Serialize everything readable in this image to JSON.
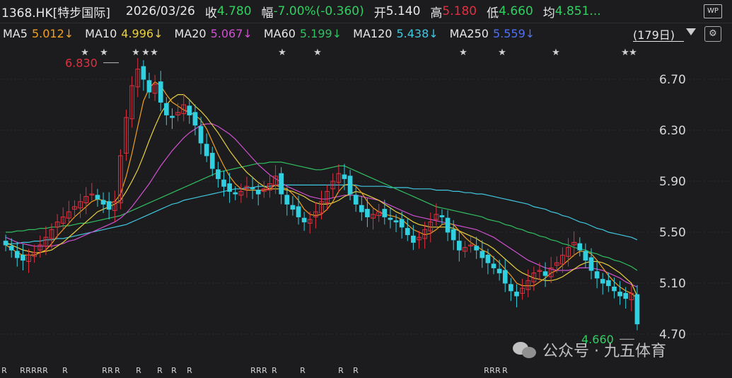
{
  "header": {
    "code": "1368.HK[特步国际]",
    "date": "2026/03/26",
    "close_label": "收",
    "close_value": "4.780",
    "change_label": "幅",
    "change_value": "-7.00%(-0.360)",
    "open_label": "开",
    "open_value": "5.140",
    "high_label": "高",
    "high_value": "5.180",
    "low_label": "低",
    "low_value": "4.660",
    "avg_label": "均",
    "avg_value": "4.851...",
    "wp_label": "WP"
  },
  "ma_bar": {
    "items": [
      {
        "label": "MA5",
        "value": "5.012↓",
        "color": "#f0a020"
      },
      {
        "label": "MA10",
        "value": "4.996↓",
        "color": "#e8d040"
      },
      {
        "label": "MA20",
        "value": "5.067↓",
        "color": "#d050d0"
      },
      {
        "label": "MA60",
        "value": "5.199↓",
        "color": "#30c060"
      },
      {
        "label": "MA120",
        "value": "5.438↓",
        "color": "#40c8e0"
      },
      {
        "label": "MA250",
        "value": "5.559↓",
        "color": "#5070f0"
      }
    ],
    "period": "(179日)"
  },
  "colors": {
    "up": "#e03040",
    "down": "#30d0e0",
    "grid": "#2a2a2e",
    "axis_text": "#d8d8d8",
    "high_label": "#e03040",
    "low_label": "#30d060"
  },
  "chart_data": {
    "type": "candlestick",
    "ylim": [
      4.6,
      6.85
    ],
    "y_ticks": [
      "6.70",
      "6.30",
      "5.90",
      "5.50",
      "5.10",
      "4.70"
    ],
    "y_tick_values": [
      6.7,
      6.3,
      5.9,
      5.5,
      5.1,
      4.7
    ],
    "annotations": {
      "max_label": "6.830",
      "min_label": "4.660"
    },
    "star_marker": "★",
    "r_marker": "R",
    "close_series": [
      5.4,
      5.36,
      5.3,
      5.28,
      5.32,
      5.34,
      5.4,
      5.46,
      5.52,
      5.58,
      5.62,
      5.66,
      5.7,
      5.74,
      5.78,
      5.8,
      5.76,
      5.72,
      5.68,
      5.74,
      6.1,
      6.4,
      6.65,
      6.78,
      6.7,
      6.6,
      6.66,
      6.52,
      6.42,
      6.4,
      6.44,
      6.5,
      6.42,
      6.34,
      6.2,
      6.1,
      6.0,
      5.92,
      5.86,
      5.82,
      5.8,
      5.82,
      5.86,
      5.84,
      5.8,
      5.84,
      5.88,
      5.94,
      5.8,
      5.72,
      5.68,
      5.62,
      5.58,
      5.6,
      5.66,
      5.74,
      5.82,
      5.9,
      5.96,
      5.92,
      5.8,
      5.72,
      5.66,
      5.62,
      5.64,
      5.66,
      5.62,
      5.6,
      5.58,
      5.54,
      5.48,
      5.42,
      5.46,
      5.52,
      5.58,
      5.64,
      5.62,
      5.5,
      5.44,
      5.36,
      5.38,
      5.4,
      5.36,
      5.3,
      5.26,
      5.22,
      5.18,
      5.1,
      5.04,
      5.0,
      5.06,
      5.12,
      5.18,
      5.2,
      5.16,
      5.22,
      5.26,
      5.32,
      5.38,
      5.42,
      5.36,
      5.28,
      5.2,
      5.14,
      5.1,
      5.08,
      5.04,
      5.0,
      4.98,
      5.02,
      4.78
    ],
    "ma5": [
      5.4,
      5.37,
      5.34,
      5.32,
      5.32,
      5.32,
      5.34,
      5.36,
      5.41,
      5.47,
      5.52,
      5.57,
      5.62,
      5.66,
      5.7,
      5.74,
      5.76,
      5.75,
      5.73,
      5.74,
      5.8,
      5.94,
      6.12,
      6.33,
      6.53,
      6.63,
      6.68,
      6.65,
      6.58,
      6.52,
      6.49,
      6.46,
      6.44,
      6.42,
      6.38,
      6.31,
      6.21,
      6.11,
      6.02,
      5.94,
      5.88,
      5.84,
      5.83,
      5.83,
      5.83,
      5.83,
      5.84,
      5.87,
      5.85,
      5.84,
      5.8,
      5.75,
      5.68,
      5.64,
      5.63,
      5.64,
      5.68,
      5.74,
      5.82,
      5.87,
      5.88,
      5.86,
      5.81,
      5.74,
      5.69,
      5.66,
      5.64,
      5.63,
      5.62,
      5.6,
      5.56,
      5.52,
      5.5,
      5.48,
      5.49,
      5.52,
      5.56,
      5.57,
      5.56,
      5.51,
      5.46,
      5.42,
      5.39,
      5.36,
      5.34,
      5.3,
      5.26,
      5.21,
      5.16,
      5.1,
      5.08,
      5.08,
      5.08,
      5.11,
      5.14,
      5.18,
      5.2,
      5.24,
      5.28,
      5.32,
      5.35,
      5.35,
      5.33,
      5.28,
      5.22,
      5.16,
      5.11,
      5.07,
      5.04,
      5.02,
      4.98
    ],
    "ma10": [
      5.42,
      5.4,
      5.38,
      5.36,
      5.35,
      5.34,
      5.34,
      5.35,
      5.36,
      5.39,
      5.42,
      5.46,
      5.5,
      5.54,
      5.58,
      5.62,
      5.66,
      5.68,
      5.7,
      5.72,
      5.75,
      5.82,
      5.9,
      5.99,
      6.1,
      6.22,
      6.33,
      6.43,
      6.5,
      6.55,
      6.58,
      6.58,
      6.54,
      6.49,
      6.45,
      6.4,
      6.34,
      6.28,
      6.21,
      6.14,
      6.08,
      6.02,
      5.97,
      5.93,
      5.89,
      5.86,
      5.84,
      5.84,
      5.84,
      5.83,
      5.82,
      5.8,
      5.78,
      5.75,
      5.73,
      5.72,
      5.72,
      5.73,
      5.75,
      5.78,
      5.8,
      5.82,
      5.81,
      5.79,
      5.77,
      5.75,
      5.72,
      5.69,
      5.66,
      5.64,
      5.61,
      5.58,
      5.56,
      5.55,
      5.54,
      5.54,
      5.54,
      5.54,
      5.53,
      5.51,
      5.49,
      5.47,
      5.45,
      5.42,
      5.4,
      5.37,
      5.33,
      5.29,
      5.25,
      5.21,
      5.18,
      5.16,
      5.14,
      5.13,
      5.12,
      5.12,
      5.13,
      5.15,
      5.18,
      5.21,
      5.24,
      5.26,
      5.27,
      5.27,
      5.26,
      5.24,
      5.21,
      5.18,
      5.14,
      5.1,
      5.0
    ],
    "ma20": [
      5.46,
      5.44,
      5.42,
      5.41,
      5.4,
      5.39,
      5.39,
      5.39,
      5.39,
      5.4,
      5.41,
      5.43,
      5.44,
      5.46,
      5.48,
      5.5,
      5.52,
      5.54,
      5.56,
      5.58,
      5.61,
      5.65,
      5.7,
      5.76,
      5.82,
      5.88,
      5.95,
      6.02,
      6.08,
      6.14,
      6.19,
      6.24,
      6.28,
      6.31,
      6.34,
      6.35,
      6.35,
      6.33,
      6.3,
      6.27,
      6.23,
      6.18,
      6.13,
      6.08,
      6.03,
      5.99,
      5.95,
      5.92,
      5.89,
      5.86,
      5.84,
      5.82,
      5.8,
      5.78,
      5.77,
      5.76,
      5.76,
      5.77,
      5.78,
      5.79,
      5.79,
      5.79,
      5.78,
      5.77,
      5.76,
      5.75,
      5.73,
      5.71,
      5.69,
      5.67,
      5.65,
      5.63,
      5.62,
      5.61,
      5.6,
      5.59,
      5.58,
      5.57,
      5.56,
      5.55,
      5.54,
      5.53,
      5.52,
      5.5,
      5.48,
      5.46,
      5.43,
      5.4,
      5.37,
      5.34,
      5.31,
      5.28,
      5.26,
      5.24,
      5.22,
      5.21,
      5.2,
      5.2,
      5.2,
      5.21,
      5.22,
      5.22,
      5.22,
      5.21,
      5.2,
      5.18,
      5.16,
      5.14,
      5.11,
      5.09,
      5.07
    ],
    "ma60": [
      5.5,
      5.5,
      5.51,
      5.51,
      5.52,
      5.52,
      5.53,
      5.53,
      5.54,
      5.54,
      5.55,
      5.55,
      5.56,
      5.57,
      5.57,
      5.58,
      5.59,
      5.6,
      5.61,
      5.62,
      5.63,
      5.65,
      5.67,
      5.69,
      5.71,
      5.73,
      5.75,
      5.77,
      5.79,
      5.81,
      5.83,
      5.85,
      5.87,
      5.89,
      5.91,
      5.93,
      5.95,
      5.97,
      5.98,
      5.99,
      6.0,
      6.01,
      6.02,
      6.03,
      6.04,
      6.04,
      6.05,
      6.05,
      6.05,
      6.04,
      6.03,
      6.02,
      6.01,
      6.0,
      5.99,
      5.99,
      6.0,
      6.01,
      6.02,
      6.02,
      6.0,
      5.98,
      5.96,
      5.94,
      5.92,
      5.9,
      5.88,
      5.86,
      5.84,
      5.82,
      5.8,
      5.78,
      5.76,
      5.74,
      5.72,
      5.7,
      5.69,
      5.68,
      5.67,
      5.66,
      5.65,
      5.64,
      5.63,
      5.62,
      5.6,
      5.59,
      5.58,
      5.56,
      5.55,
      5.53,
      5.52,
      5.5,
      5.49,
      5.47,
      5.46,
      5.44,
      5.43,
      5.41,
      5.4,
      5.38,
      5.37,
      5.36,
      5.34,
      5.33,
      5.31,
      5.3,
      5.28,
      5.27,
      5.25,
      5.23,
      5.2
    ],
    "ma120": [
      5.4,
      5.41,
      5.41,
      5.42,
      5.42,
      5.43,
      5.43,
      5.44,
      5.44,
      5.45,
      5.45,
      5.46,
      5.47,
      5.48,
      5.49,
      5.5,
      5.51,
      5.52,
      5.53,
      5.54,
      5.55,
      5.56,
      5.58,
      5.6,
      5.62,
      5.64,
      5.66,
      5.68,
      5.7,
      5.72,
      5.73,
      5.75,
      5.76,
      5.77,
      5.78,
      5.79,
      5.8,
      5.81,
      5.82,
      5.83,
      5.84,
      5.84,
      5.85,
      5.85,
      5.86,
      5.86,
      5.86,
      5.87,
      5.87,
      5.87,
      5.87,
      5.87,
      5.87,
      5.87,
      5.87,
      5.87,
      5.87,
      5.87,
      5.87,
      5.87,
      5.87,
      5.87,
      5.86,
      5.86,
      5.86,
      5.86,
      5.86,
      5.85,
      5.85,
      5.85,
      5.85,
      5.84,
      5.84,
      5.84,
      5.84,
      5.83,
      5.83,
      5.83,
      5.82,
      5.82,
      5.81,
      5.81,
      5.8,
      5.8,
      5.79,
      5.78,
      5.77,
      5.76,
      5.75,
      5.74,
      5.73,
      5.72,
      5.7,
      5.69,
      5.68,
      5.66,
      5.65,
      5.63,
      5.62,
      5.6,
      5.58,
      5.57,
      5.55,
      5.53,
      5.52,
      5.5,
      5.49,
      5.48,
      5.47,
      5.46,
      5.44
    ]
  },
  "watermark": {
    "text": "公众号 · 九五体育"
  }
}
